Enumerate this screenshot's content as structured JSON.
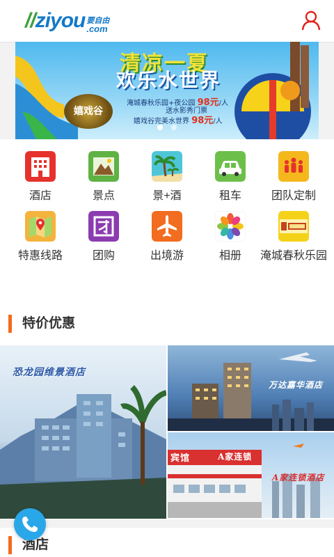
{
  "header": {
    "logo_main": "ziyou",
    "logo_cn": "要自由",
    "logo_com": ".com",
    "user_icon": "user-icon"
  },
  "banner": {
    "title_line1": "清凉一夏",
    "title_line2": "欢乐水世界",
    "line1": "淹城春秋乐园+夜公园",
    "line1_price": "98元",
    "line1_unit": "/人",
    "line2": "送水影秀门票",
    "line3": "嬉戏谷完美水世界",
    "line3_price": "98元",
    "line3_unit": "/人",
    "badge": "嬉戏谷",
    "dots": 2,
    "active_dot": 0
  },
  "menu": {
    "items": [
      {
        "label": "酒店",
        "icon": "hotel-icon",
        "color": "#e5322d"
      },
      {
        "label": "景点",
        "icon": "mountain-icon",
        "color": "#5fb244"
      },
      {
        "label": "景+酒",
        "icon": "palm-tree-icon",
        "color": "#4fc6d8"
      },
      {
        "label": "租车",
        "icon": "car-icon",
        "color": "#6cc04a"
      },
      {
        "label": "团队定制",
        "icon": "group-icon",
        "color": "#f5b81c"
      },
      {
        "label": "特惠线路",
        "icon": "map-pin-icon",
        "color": "#f3b33d"
      },
      {
        "label": "团购",
        "icon": "group-buy-icon",
        "color": "#8b3cb0"
      },
      {
        "label": "出境游",
        "icon": "airplane-icon",
        "color": "#f26d1f"
      },
      {
        "label": "相册",
        "icon": "photo-flower-icon",
        "color": "#ffffff"
      },
      {
        "label": "淹城春秋乐园",
        "icon": "park-logo-icon",
        "color": "#f5d21a"
      }
    ]
  },
  "sections": {
    "promo_title": "特价优惠",
    "hotel_title": "酒店"
  },
  "promo": {
    "hotel1": "恐龙园维景酒店",
    "hotel2": "万达嘉华酒店",
    "hotel3": "A家连锁酒店",
    "hotel3_sign": "宾馆",
    "hotel3_sign2": "A家连锁"
  },
  "colors": {
    "accent": "#f46a1c",
    "brand_blue": "#1479c9",
    "user_red": "#e2231a",
    "phone": "#2aa7e8"
  }
}
